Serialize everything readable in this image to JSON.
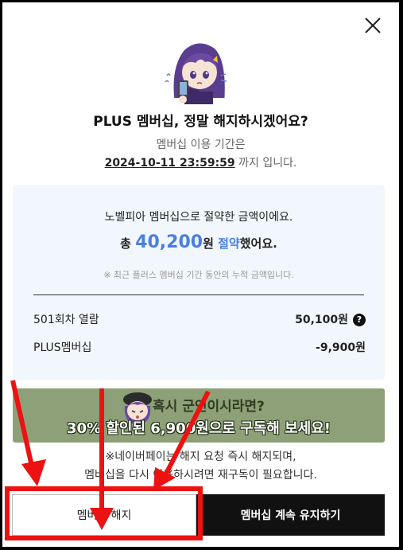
{
  "modal": {
    "title": "PLUS 멤버십, 정말 해지하시겠어요?",
    "period_label": "멤버십 이용 기간은",
    "period_date": "2024-10-11 23:59:59",
    "period_suffix": " 까지 입니다."
  },
  "savings": {
    "line1": "노벨피아 멤버십으로 절약한 금액이에요.",
    "prefix": "총 ",
    "amount": "40,200",
    "unit": "원 ",
    "save_word": "절약",
    "suffix": "했어요.",
    "note": "※ 최근 플러스 멤버십 기간 동안의 누적 금액입니다.",
    "rows": [
      {
        "label": "501회차 열람",
        "value": "50,100원"
      },
      {
        "label": "PLUS멤버십",
        "value": "-9,900원"
      }
    ],
    "help_symbol": "?"
  },
  "promo": {
    "line1": "혹시 군인이시라면?",
    "line2": "30% 할인된 6,900원으로 구독해 보세요!"
  },
  "notice": {
    "line1": "※네이버페이는 해지 요청 즉시 해지되며,",
    "line2": "멤버십을 다시 이용하시려면 재구독이 필요합니다."
  },
  "buttons": {
    "cancel": "멤버십 해지",
    "keep": "멤버십 계속 유지하기"
  },
  "colors": {
    "accent_blue": "#4a7fe0",
    "promo_green": "#8da077",
    "annotation_red": "#ee1111"
  },
  "icons": {
    "close": "close-icon",
    "help": "help-icon",
    "mascot": "mascot-illustration"
  }
}
